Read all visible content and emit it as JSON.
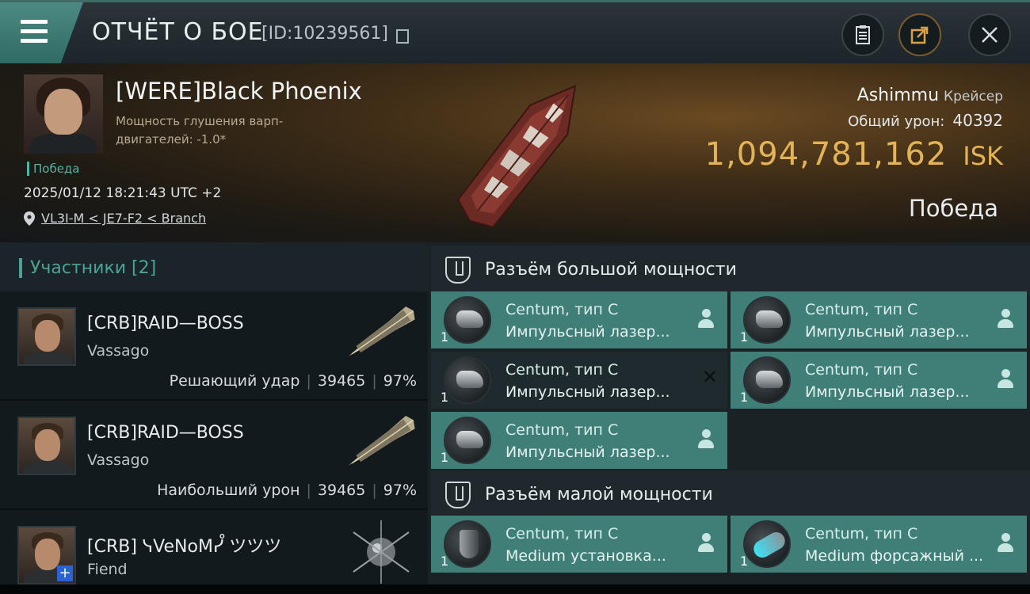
{
  "header": {
    "title": "ОТЧЁТ О БОЕ",
    "report_id": "[ID:10239561]",
    "icons": [
      "menu-icon",
      "clipboard-icon",
      "share-icon",
      "close-icon"
    ]
  },
  "victim": {
    "pilot_name": "[WERE]Black Phoenix",
    "attribute_line": "Мощность глушения варп-двигателей: -1.0*",
    "status_small": "Победа",
    "datetime": "2025/01/12 18:21:43 UTC +2",
    "location": "VL3I-M < JE7-F2 < Branch",
    "ship_name": "Ashimmu",
    "ship_class": "Крейсер",
    "total_damage_label": "Общий урон:",
    "total_damage": "40392",
    "isk_value": "1,094,781,162",
    "isk_unit": "ISK",
    "result": "Победа"
  },
  "participants": {
    "header": "Участники [2]",
    "rows": [
      {
        "name": "[CRB]RAID—BOSS",
        "ship": "Vassago",
        "stat_label": "Решающий удар",
        "damage": "39465",
        "percent": "97%"
      },
      {
        "name": "[CRB]RAID—BOSS",
        "ship": "Vassago",
        "stat_label": "Наибольший урон",
        "damage": "39465",
        "percent": "97%"
      },
      {
        "name": "[CRB] ᓭVeNoMᓮ ツツツ",
        "ship": "Fiend",
        "stat_label": "",
        "damage": "",
        "percent": ""
      }
    ]
  },
  "fitting": {
    "high_slot_label": "Разъём большой мощности",
    "low_slot_label": "Разъём малой мощности",
    "high_modules": [
      {
        "name": "Centum, тип C",
        "desc": "Импульсный лазер...",
        "qty": "1"
      },
      {
        "name": "Centum, тип C",
        "desc": "Импульсный лазер...",
        "qty": "1"
      },
      {
        "name": "Centum, тип C",
        "desc": "Импульсный лазер...",
        "qty": "1"
      },
      {
        "name": "Centum, тип C",
        "desc": "Импульсный лазер...",
        "qty": "1"
      },
      {
        "name": "Centum, тип C",
        "desc": "Импульсный лазер...",
        "qty": "1"
      }
    ],
    "low_modules": [
      {
        "name": "Centum, тип C",
        "desc": "Medium установка...",
        "qty": "1"
      },
      {
        "name": "Centum, тип C",
        "desc": "Medium форсажный ...",
        "qty": "1"
      }
    ]
  },
  "colors": {
    "accent_teal": "#3f7f78",
    "isk_gold": "#e3b457",
    "status_green": "#54b3a3"
  }
}
